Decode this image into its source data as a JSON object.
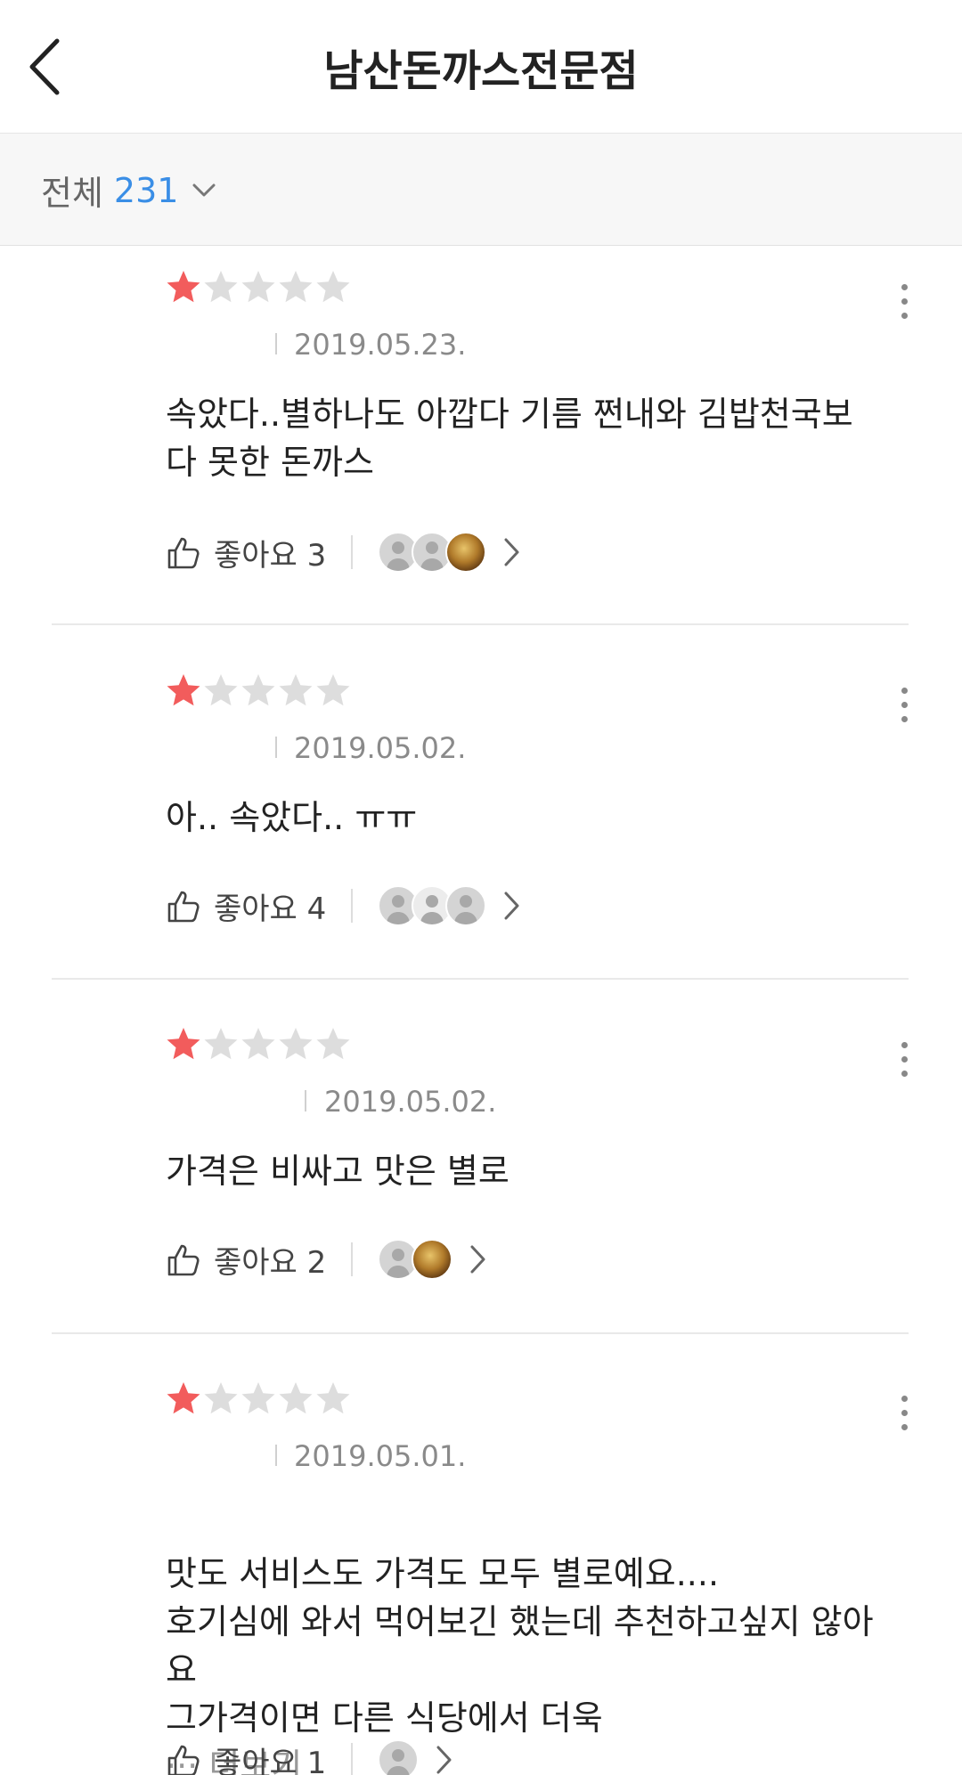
{
  "header": {
    "title": "남산돈까스전문점"
  },
  "filter": {
    "label": "전체",
    "count": "231"
  },
  "colors": {
    "star_on": "#f25c5c",
    "star_off": "#dddddd",
    "count": "#3a8ee6"
  },
  "reviews": [
    {
      "rating": 1,
      "date": "2019.05.23.",
      "text": "속았다..별하나도 아깝다 기름 쩐내와 김밥천국보\n다 못한 돈까스",
      "like_label": "좋아요 3",
      "avatars": [
        "gray",
        "gray",
        "photo"
      ]
    },
    {
      "rating": 1,
      "date": "2019.05.02.",
      "text": "아.. 속았다.. ㅠㅠ",
      "like_label": "좋아요 4",
      "avatars": [
        "gray",
        "light",
        "gray"
      ]
    },
    {
      "rating": 1,
      "date": "2019.05.02.",
      "text": "가격은 비싸고 맛은 별로",
      "like_label": "좋아요 2",
      "avatars": [
        "gray",
        "photo"
      ]
    },
    {
      "rating": 1,
      "date": "2019.05.01.",
      "text": "맛도 서비스도 가격도 모두 별로예요....\n호기심에 와서 먹어보긴 했는데 추천하고싶지 않아\n요\n그가격이면 다른 식당에서 더욱",
      "more_label": "··· 더보기",
      "like_label": "좋아요 1",
      "avatars": [
        "gray"
      ]
    }
  ]
}
